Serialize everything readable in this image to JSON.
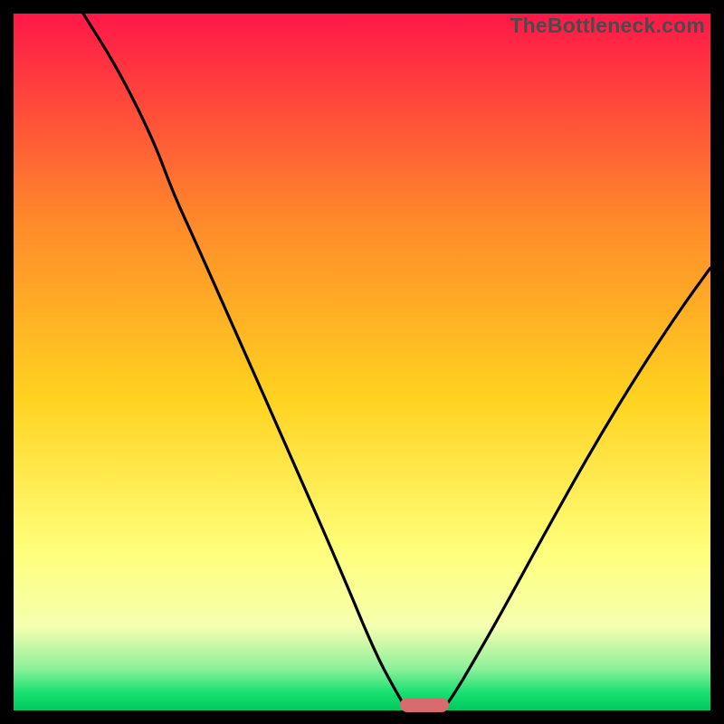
{
  "watermark": "TheBottleneck.com",
  "colors": {
    "top": "#ff1748",
    "mid_upper": "#ff8a2a",
    "mid": "#ffd21f",
    "mid_lower": "#ffff7a",
    "low": "#f5ffb0",
    "green_light": "#8df09a",
    "green": "#17e070",
    "green_deep": "#00c85e",
    "marker": "#d96a6d",
    "frame": "#000000"
  },
  "chart_data": {
    "type": "line",
    "title": "",
    "xlabel": "",
    "ylabel": "",
    "xlim": [
      0,
      100
    ],
    "ylim": [
      0,
      100
    ],
    "grid": false,
    "legend": false,
    "curve": [
      {
        "x": 10.0,
        "y": 100.0
      },
      {
        "x": 15.0,
        "y": 92.0
      },
      {
        "x": 20.0,
        "y": 82.0
      },
      {
        "x": 23.0,
        "y": 74.0
      },
      {
        "x": 26.0,
        "y": 67.5
      },
      {
        "x": 32.0,
        "y": 54.0
      },
      {
        "x": 40.0,
        "y": 36.0
      },
      {
        "x": 47.0,
        "y": 20.0
      },
      {
        "x": 52.0,
        "y": 8.0
      },
      {
        "x": 55.0,
        "y": 2.5
      },
      {
        "x": 56.5,
        "y": 0.0
      },
      {
        "x": 61.5,
        "y": 0.0
      },
      {
        "x": 63.0,
        "y": 2.0
      },
      {
        "x": 66.0,
        "y": 7.0
      },
      {
        "x": 70.0,
        "y": 14.0
      },
      {
        "x": 76.0,
        "y": 25.0
      },
      {
        "x": 83.0,
        "y": 37.5
      },
      {
        "x": 90.0,
        "y": 49.0
      },
      {
        "x": 96.0,
        "y": 58.0
      },
      {
        "x": 100.0,
        "y": 63.5
      }
    ],
    "marker": {
      "x_start": 55.5,
      "x_end": 62.5,
      "y": 0.0
    }
  }
}
